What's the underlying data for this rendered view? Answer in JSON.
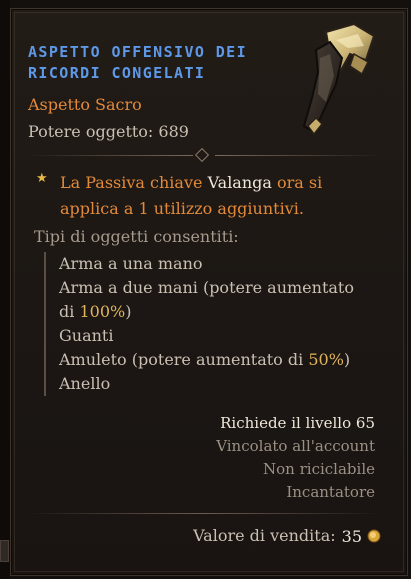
{
  "item": {
    "title_line1": "ASPETTO OFFENSIVO DEI",
    "title_line2": "RICORDI CONGELATI",
    "rarity": "Aspetto Sacro",
    "power": "Potere oggetto: 689",
    "affix": {
      "p1": "La Passiva chiave ",
      "p2": "Valanga",
      "p3": " ora si applica a 1 utilizzo aggiuntivi."
    },
    "types_label": "Tipi di oggetti consentiti:",
    "types": {
      "t1": "Arma a una mano",
      "t2a": "Arma a due mani (potere aumentato",
      "t2b_pre": "di ",
      "t2b_val": "100%",
      "t2b_post": ")",
      "t3": "Guanti",
      "t4_pre": "Amuleto (potere aumentato di ",
      "t4_val": "50%",
      "t4_post": ")",
      "t5": "Anello"
    },
    "requirements": {
      "level": "Richiede il livello 65",
      "bound": "Vincolato all'account",
      "salvage": "Non riciclabile",
      "source": "Incantatore"
    },
    "sell": {
      "label": "Valore di vendita:",
      "value": "35",
      "icon": "gold-coin-icon"
    }
  },
  "colors": {
    "title": "#5e98e8",
    "rarity": "#e38a3a",
    "highlight": "#e0b45a"
  }
}
